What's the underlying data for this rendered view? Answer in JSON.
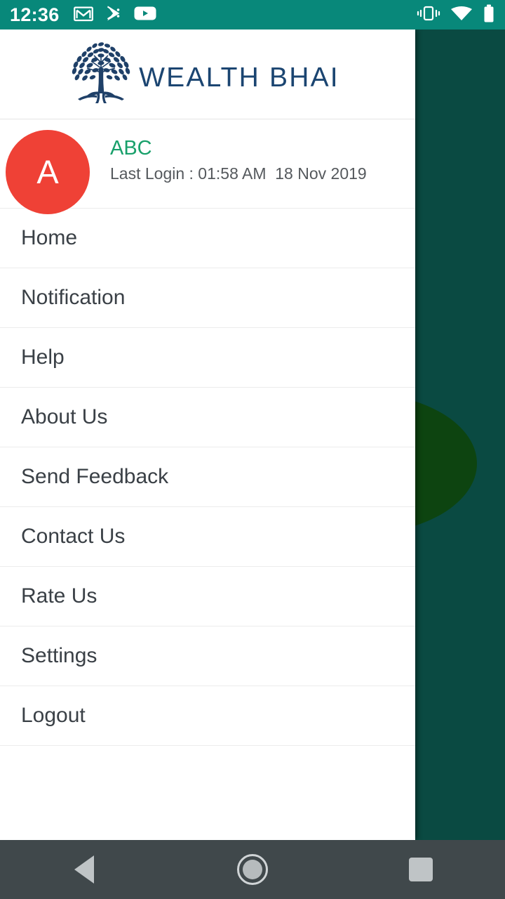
{
  "status_bar": {
    "time": "12:36",
    "left_icons": [
      "gmail-icon",
      "play-store-icon",
      "youtube-icon"
    ],
    "right_icons": [
      "vibrate-icon",
      "wifi-icon",
      "battery-icon"
    ],
    "background_color": "#08887a"
  },
  "drawer": {
    "background_color": "#ffffff",
    "header": {
      "logo_icon": "tree-logo-icon",
      "brand_title": "WEALTH BHAI",
      "brand_color": "#1b4571"
    },
    "profile": {
      "avatar_letter": "A",
      "avatar_color": "#ef4136",
      "name": "ABC",
      "name_color": "#19a06b",
      "last_login": "Last Login : 01:58 AM  18 Nov 2019"
    },
    "menu_items": [
      {
        "label": "Home"
      },
      {
        "label": "Notification"
      },
      {
        "label": "Help"
      },
      {
        "label": "About Us"
      },
      {
        "label": "Send Feedback"
      },
      {
        "label": "Contact Us"
      },
      {
        "label": "Rate Us"
      },
      {
        "label": "Settings"
      },
      {
        "label": "Logout"
      }
    ]
  },
  "app_background": {
    "base_color": "#0a4a42",
    "circle_color": "#0d4410"
  },
  "nav_bar": {
    "background_color": "#40484b",
    "buttons": [
      "back-button",
      "home-button",
      "recents-button"
    ]
  }
}
